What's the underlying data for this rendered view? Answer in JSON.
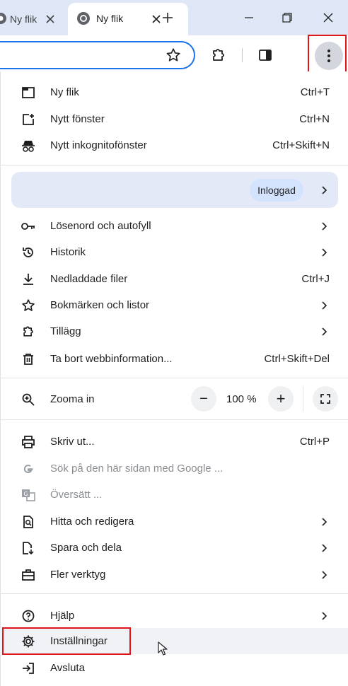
{
  "tabs": [
    {
      "title": "Ny flik",
      "active": false
    },
    {
      "title": "Ny flik",
      "active": true
    }
  ],
  "toolbar": {
    "icons": [
      "star-icon",
      "extensions-icon",
      "side-panel-icon",
      "more-menu-icon"
    ]
  },
  "menu": {
    "group1": [
      {
        "label": "Ny flik",
        "shortcut": "Ctrl+T",
        "icon": "new-tab-icon"
      },
      {
        "label": "Nytt fönster",
        "shortcut": "Ctrl+N",
        "icon": "new-window-icon"
      },
      {
        "label": "Nytt inkognitofönster",
        "shortcut": "Ctrl+Skift+N",
        "icon": "incognito-icon"
      }
    ],
    "profile": {
      "status": "Inloggad"
    },
    "group2": [
      {
        "label": "Lösenord och autofyll",
        "icon": "key-icon"
      },
      {
        "label": "Historik",
        "icon": "history-icon"
      },
      {
        "label": "Nedladdade filer",
        "shortcut": "Ctrl+J",
        "icon": "download-icon"
      },
      {
        "label": "Bokmärken och listor",
        "icon": "star-icon"
      },
      {
        "label": "Tillägg",
        "icon": "extensions-icon"
      },
      {
        "label": "Ta bort webbinformation...",
        "shortcut": "Ctrl+Skift+Del",
        "icon": "trash-icon"
      }
    ],
    "zoom": {
      "label": "Zooma in",
      "value": "100 %",
      "minus": "−",
      "plus": "+"
    },
    "group3": [
      {
        "label": "Skriv ut...",
        "shortcut": "Ctrl+P",
        "icon": "print-icon"
      },
      {
        "label": "Sök på den här sidan med Google ...",
        "icon": "google-icon",
        "disabled": true
      },
      {
        "label": "Översätt ...",
        "icon": "translate-icon",
        "disabled": true
      },
      {
        "label": "Hitta och redigera",
        "icon": "find-icon"
      },
      {
        "label": "Spara och dela",
        "icon": "save-share-icon"
      },
      {
        "label": "Fler verktyg",
        "icon": "toolbox-icon"
      }
    ],
    "group4": [
      {
        "label": "Hjälp",
        "icon": "help-icon"
      },
      {
        "label": "Inställningar",
        "icon": "gear-icon"
      },
      {
        "label": "Avsluta",
        "icon": "exit-icon"
      }
    ]
  },
  "colors": {
    "highlight": "#e0151a",
    "accent": "#1a73e8",
    "tabbar": "#dfe7f6",
    "profile_bg": "#e3e9f6"
  }
}
